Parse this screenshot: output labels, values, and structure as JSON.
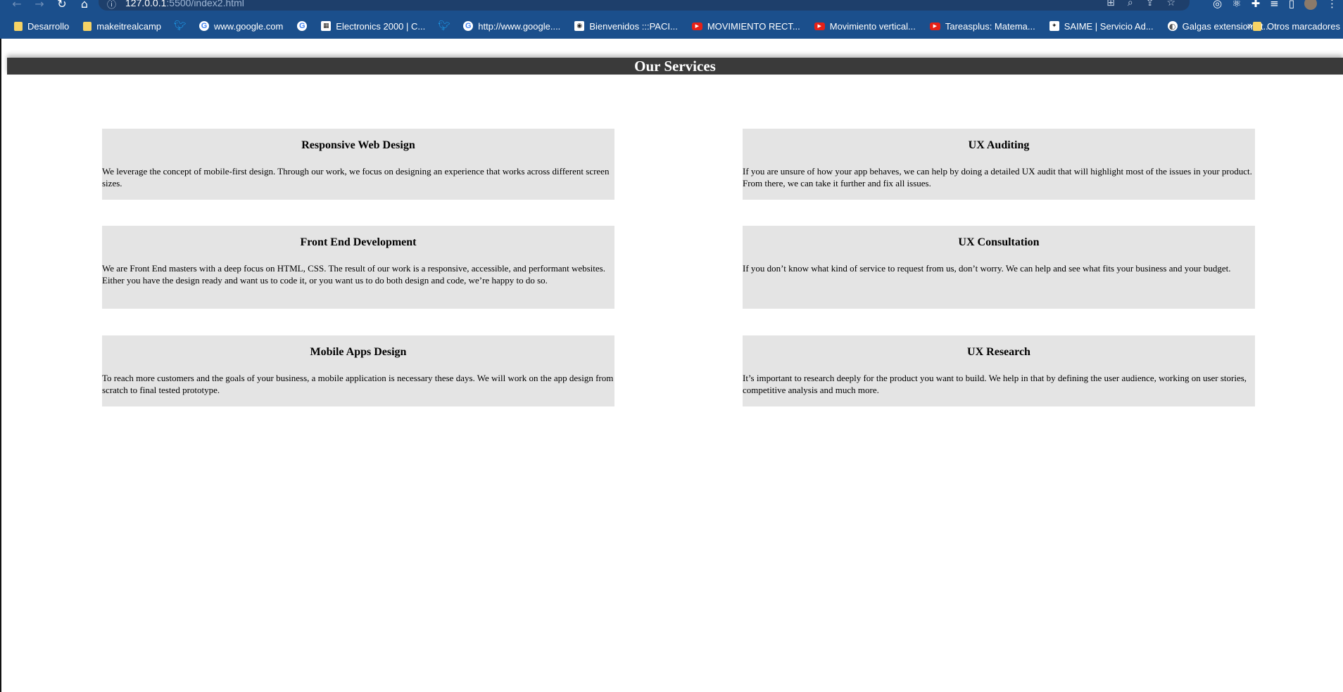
{
  "browser": {
    "url_host": "127.0.0.1",
    "url_rest": ":5500/index2.html",
    "bookmarks": [
      {
        "label": "Desarrollo",
        "icon": "folder-icon"
      },
      {
        "label": "makeitrealcamp",
        "icon": "folder-icon"
      },
      {
        "label": "",
        "icon": "twitter-icon"
      },
      {
        "label": "www.google.com",
        "icon": "google-icon"
      },
      {
        "label": "",
        "icon": "google-icon"
      },
      {
        "label": "Electronics 2000 | C...",
        "icon": "site-icon"
      },
      {
        "label": "",
        "icon": "twitter-icon"
      },
      {
        "label": "http://www.google....",
        "icon": "google-icon"
      },
      {
        "label": "Bienvenidos :::PACI...",
        "icon": "site-icon"
      },
      {
        "label": "MOVIMIENTO RECT...",
        "icon": "youtube-icon"
      },
      {
        "label": "Movimiento vertical...",
        "icon": "youtube-icon"
      },
      {
        "label": "Tareasplus: Matema...",
        "icon": "youtube-icon"
      },
      {
        "label": "SAIME | Servicio Ad...",
        "icon": "site-icon"
      },
      {
        "label": "Galgas extensiomét...",
        "icon": "globe-icon"
      }
    ],
    "more_bookmarks_glyph": "»",
    "other_bookmarks": "Otros marcadores"
  },
  "page": {
    "title": "Our Services",
    "services": [
      {
        "title": "Responsive Web Design",
        "description": "We leverage the concept of mobile-first design. Through our work, we focus on designing an experience that works across different screen sizes."
      },
      {
        "title": "UX Auditing",
        "description": "If you are unsure of how your app behaves, we can help by doing a detailed UX audit that will highlight most of the issues in your product. From there, we can take it further and fix all issues."
      },
      {
        "title": "Front End Development",
        "description": "We are Front End masters with a deep focus on HTML, CSS. The result of our work is a responsive, accessible, and performant websites. Either you have the design ready and want us to code it, or you want us to do both design and code, we’re happy to do so."
      },
      {
        "title": "UX Consultation",
        "description": "If you don’t know what kind of service to request from us, don’t worry. We can help and see what fits your business and your budget."
      },
      {
        "title": "Mobile Apps Design",
        "description": "To reach more customers and the goals of your business, a mobile application is necessary these days. We will work on the app design from scratch to final tested prototype."
      },
      {
        "title": "UX Research",
        "description": "It’s important to research deeply for the product you want to build. We help in that by defining the user audience, working on user stories, competitive analysis and much more."
      }
    ]
  },
  "colors": {
    "chrome_bg": "#1b4f8c",
    "header_bg": "#3a3a3a",
    "card_bg": "#e4e4e4"
  }
}
